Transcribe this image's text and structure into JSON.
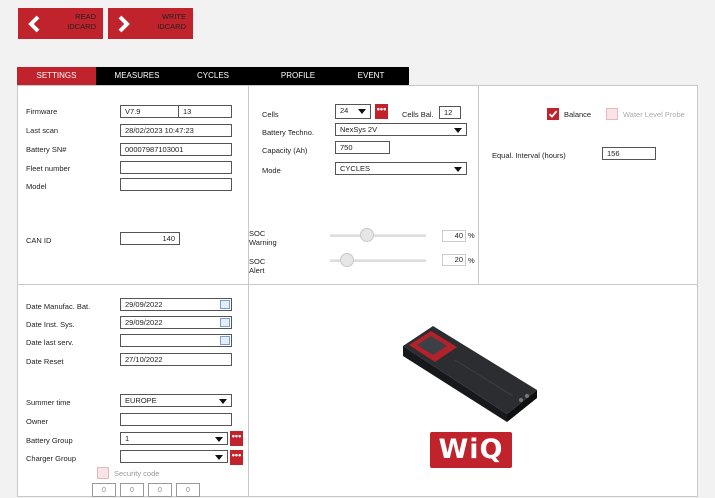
{
  "top_buttons": {
    "read": "READ\nIDCARD",
    "write": "WRITE\nIDCARD"
  },
  "tabs": [
    "SETTINGS",
    "MEASURES",
    "CYCLES",
    "PROFILE",
    "EVENT"
  ],
  "identity": {
    "firmware_label": "Firmware",
    "firmware": "V7.9",
    "firmware_build": "13",
    "last_scan_label": "Last scan",
    "last_scan": "28/02/2023 10:47:23",
    "battery_sn_label": "Battery SN#",
    "battery_sn": "00007987103001",
    "fleet_label": "Fleet number",
    "fleet": "",
    "model_label": "Model",
    "model": "",
    "can_id_label": "CAN ID",
    "can_id": "140"
  },
  "battery": {
    "cells_label": "Cells",
    "cells": "24",
    "cells_bal_label": "Cells Bal.",
    "cells_bal": "12",
    "techno_label": "Battery Techno.",
    "techno": "NexSys 2V",
    "capacity_label": "Capacity (Ah)",
    "capacity": "750",
    "mode_label": "Mode",
    "mode": "CYCLES",
    "soc_warning_label": "SOC\nWarning",
    "soc_warning": "40",
    "soc_alert_label": "SOC\nAlert",
    "soc_alert": "20",
    "percent_sign": "%"
  },
  "options": {
    "balance_label": "Balance",
    "balance_checked": true,
    "water_probe_label": "Water Level Probe",
    "water_probe_checked": false,
    "equal_interval_label": "Equal. Interval  (hours)",
    "equal_interval": "156"
  },
  "dates": {
    "manufac_label": "Date Manufac. Bat.",
    "manufac": "29/09/2022",
    "inst_label": "Date Inst. Sys.",
    "inst": "29/09/2022",
    "last_serv_label": "Date last serv.",
    "last_serv": "",
    "reset_label": "Date Reset",
    "reset": "27/10/2022"
  },
  "misc": {
    "summer_label": "Summer time",
    "summer": "EUROPE",
    "owner_label": "Owner",
    "owner": "",
    "battery_group_label": "Battery Group",
    "battery_group": "1",
    "charger_group_label": "Charger Group",
    "charger_group": "",
    "security_label": "Security code",
    "security_digits": [
      "0",
      "0",
      "0",
      "0"
    ]
  },
  "brand": {
    "logo_text": "WiQ"
  },
  "colors": {
    "accent": "#c0232c",
    "tabbar": "#000000",
    "panel": "#ffffff",
    "background": "#f2f2f2"
  }
}
